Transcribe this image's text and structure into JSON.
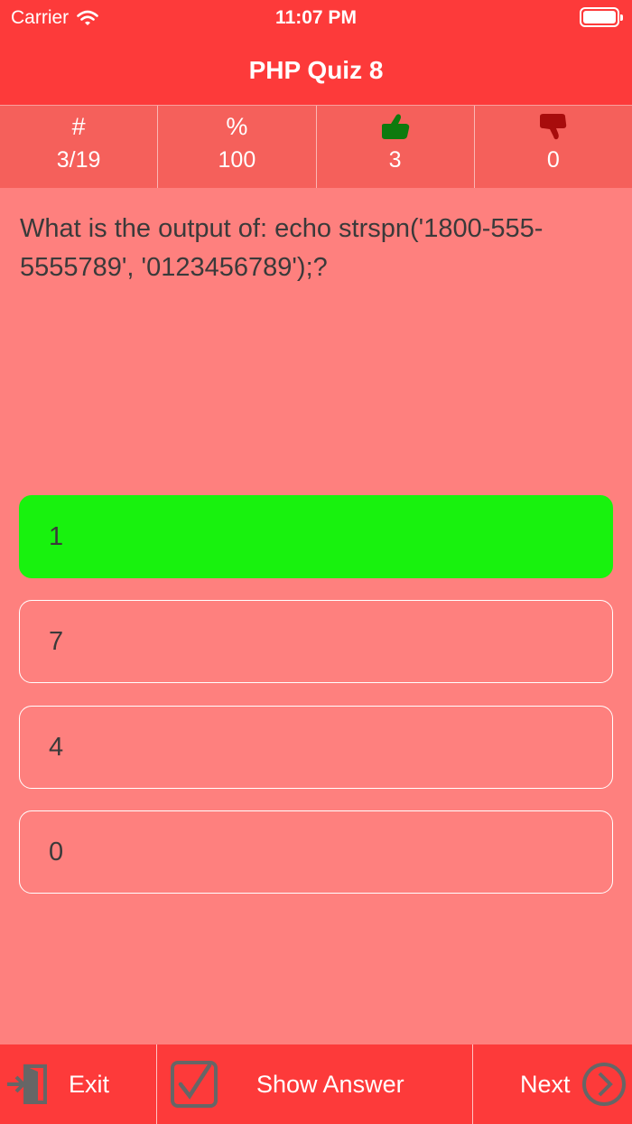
{
  "status_bar": {
    "carrier": "Carrier",
    "time": "11:07 PM"
  },
  "nav": {
    "title": "PHP Quiz 8"
  },
  "stats": [
    {
      "head": "#",
      "value": "3/19",
      "icon": "hash-icon"
    },
    {
      "head": "%",
      "value": "100",
      "icon": "percent-icon"
    },
    {
      "head": "",
      "value": "3",
      "icon": "thumbs-up-icon"
    },
    {
      "head": "",
      "value": "0",
      "icon": "thumbs-down-icon"
    }
  ],
  "question": "What is the output of: echo strspn('1800-555-5555789', '0123456789');?",
  "answers": [
    {
      "label": "1",
      "state": "correct"
    },
    {
      "label": "7",
      "state": "default"
    },
    {
      "label": "4",
      "state": "default"
    },
    {
      "label": "0",
      "state": "default"
    }
  ],
  "toolbar": {
    "exit_label": "Exit",
    "show_answer_label": "Show Answer",
    "next_label": "Next"
  },
  "colors": {
    "header": "#fd3a3a",
    "background": "#fe807e",
    "stats_bar": "#f5605b",
    "correct": "#18f20e",
    "thumbs_up": "#0e7a0e",
    "thumbs_down": "#a80c0c",
    "icon_gray": "#666666"
  }
}
